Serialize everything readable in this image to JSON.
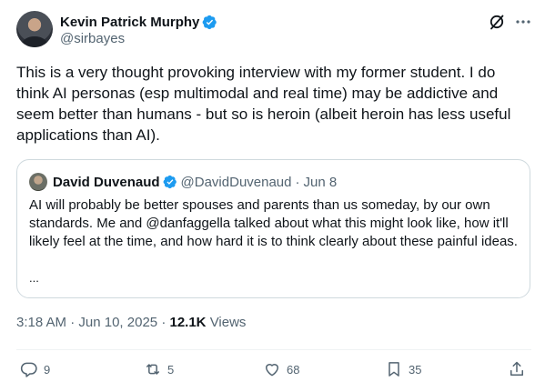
{
  "author": {
    "name": "Kevin Patrick Murphy",
    "handle": "@sirbayes"
  },
  "icons": {
    "verified": "verified-badge-icon",
    "grok": "grok-icon",
    "more": "more-options-icon",
    "reply": "reply-icon",
    "retweet": "retweet-icon",
    "like": "like-icon",
    "bookmark": "bookmark-icon",
    "share": "share-icon"
  },
  "colors": {
    "verified": "#1d9bf0",
    "text": "#0f1419",
    "secondary": "#536471",
    "border": "#cfd9de"
  },
  "tweet": {
    "text": "This is a very thought provoking interview with my former student. I do think AI personas (esp multimodal and real time) may be addictive and seem better than humans - but so is heroin (albeit heroin has less useful applications than AI)."
  },
  "quote": {
    "name": "David Duvenaud",
    "handle": "@DavidDuvenaud",
    "separator": "·",
    "date": "Jun 8",
    "text": "AI will probably be better spouses and parents than us someday, by our own standards.  Me and @danfaggella talked about what this might look like, how it'll likely feel at the time, and how hard it is to think clearly about these painful ideas.",
    "ellipsis": "..."
  },
  "meta": {
    "time": "3:18 AM",
    "separator": "·",
    "date": "Jun 10, 2025",
    "views_count": "12.1K",
    "views_label": "Views"
  },
  "actions": {
    "replies": "9",
    "retweets": "5",
    "likes": "68",
    "bookmarks": "35"
  }
}
